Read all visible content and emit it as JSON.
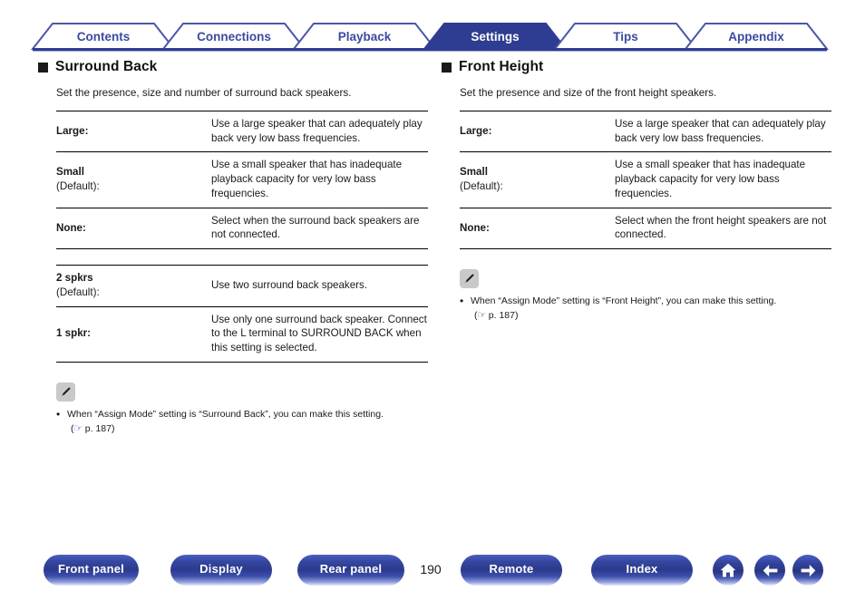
{
  "tabs": [
    {
      "label": "Contents",
      "active": false
    },
    {
      "label": "Connections",
      "active": false
    },
    {
      "label": "Playback",
      "active": false
    },
    {
      "label": "Settings",
      "active": true
    },
    {
      "label": "Tips",
      "active": false
    },
    {
      "label": "Appendix",
      "active": false
    }
  ],
  "colors": {
    "brand_blue": "#2f3f96",
    "tab_border": "#4a57a8",
    "tab_active_bg": "#2e3d91",
    "tab_text": "#3b4aa0",
    "tab_active_text": "#ffffff",
    "rule": "#000000",
    "note_icon_bg": "#c9c9c9"
  },
  "sections": [
    {
      "bullet_icon": "square-bullet-icon",
      "heading": "Surround Back",
      "description": "Set the presence, size and number of surround back speakers.",
      "tables": [
        {
          "rows": [
            {
              "term": "Large:",
              "default": "",
              "desc": "Use a large speaker that can adequately play back very low bass frequencies."
            },
            {
              "term": "Small",
              "default": "(Default):",
              "desc": "Use a small speaker that has inadequate playback capacity for very low bass frequencies."
            },
            {
              "term": "None:",
              "default": "",
              "desc": "Select when the surround back speakers are not connected."
            }
          ]
        },
        {
          "rows": [
            {
              "term": "2 spkrs",
              "default": "(Default):",
              "desc": "Use two surround back speakers."
            },
            {
              "term": "1 spkr:",
              "default": "",
              "desc": "Use only one surround back speaker. Connect to the L terminal to SURROUND BACK when this setting is selected."
            }
          ]
        }
      ],
      "note": {
        "icon": "pencil-note-icon",
        "bullet": "•",
        "text": "When “Assign Mode” setting is “Surround Back”, you can make this setting.",
        "ref_open": "(",
        "ref_hand": "☞",
        "ref_page": "p. 187",
        "ref_close": ")"
      }
    },
    {
      "bullet_icon": "square-bullet-icon",
      "heading": "Front Height",
      "description": "Set the presence and size of the front height speakers.",
      "tables": [
        {
          "rows": [
            {
              "term": "Large:",
              "default": "",
              "desc": "Use a large speaker that can adequately play back very low bass frequencies."
            },
            {
              "term": "Small",
              "default": "(Default):",
              "desc": "Use a small speaker that has inadequate playback capacity for very low bass frequencies."
            },
            {
              "term": "None:",
              "default": "",
              "desc": "Select when the front height speakers are not connected."
            }
          ]
        }
      ],
      "note": {
        "icon": "pencil-note-icon",
        "bullet": "•",
        "text": "When “Assign Mode” setting is “Front Height”, you can make this setting.",
        "ref_open": "(",
        "ref_hand": "☞",
        "ref_page": "p. 187",
        "ref_close": ")"
      }
    }
  ],
  "footer": {
    "buttons": [
      {
        "label": "Front panel"
      },
      {
        "label": "Display"
      },
      {
        "label": "Rear panel"
      },
      {
        "label": "Remote"
      },
      {
        "label": "Index"
      }
    ],
    "page_number": "190",
    "icon_buttons": [
      {
        "name": "home-icon"
      },
      {
        "name": "arrow-left-icon"
      },
      {
        "name": "arrow-right-icon"
      }
    ]
  }
}
